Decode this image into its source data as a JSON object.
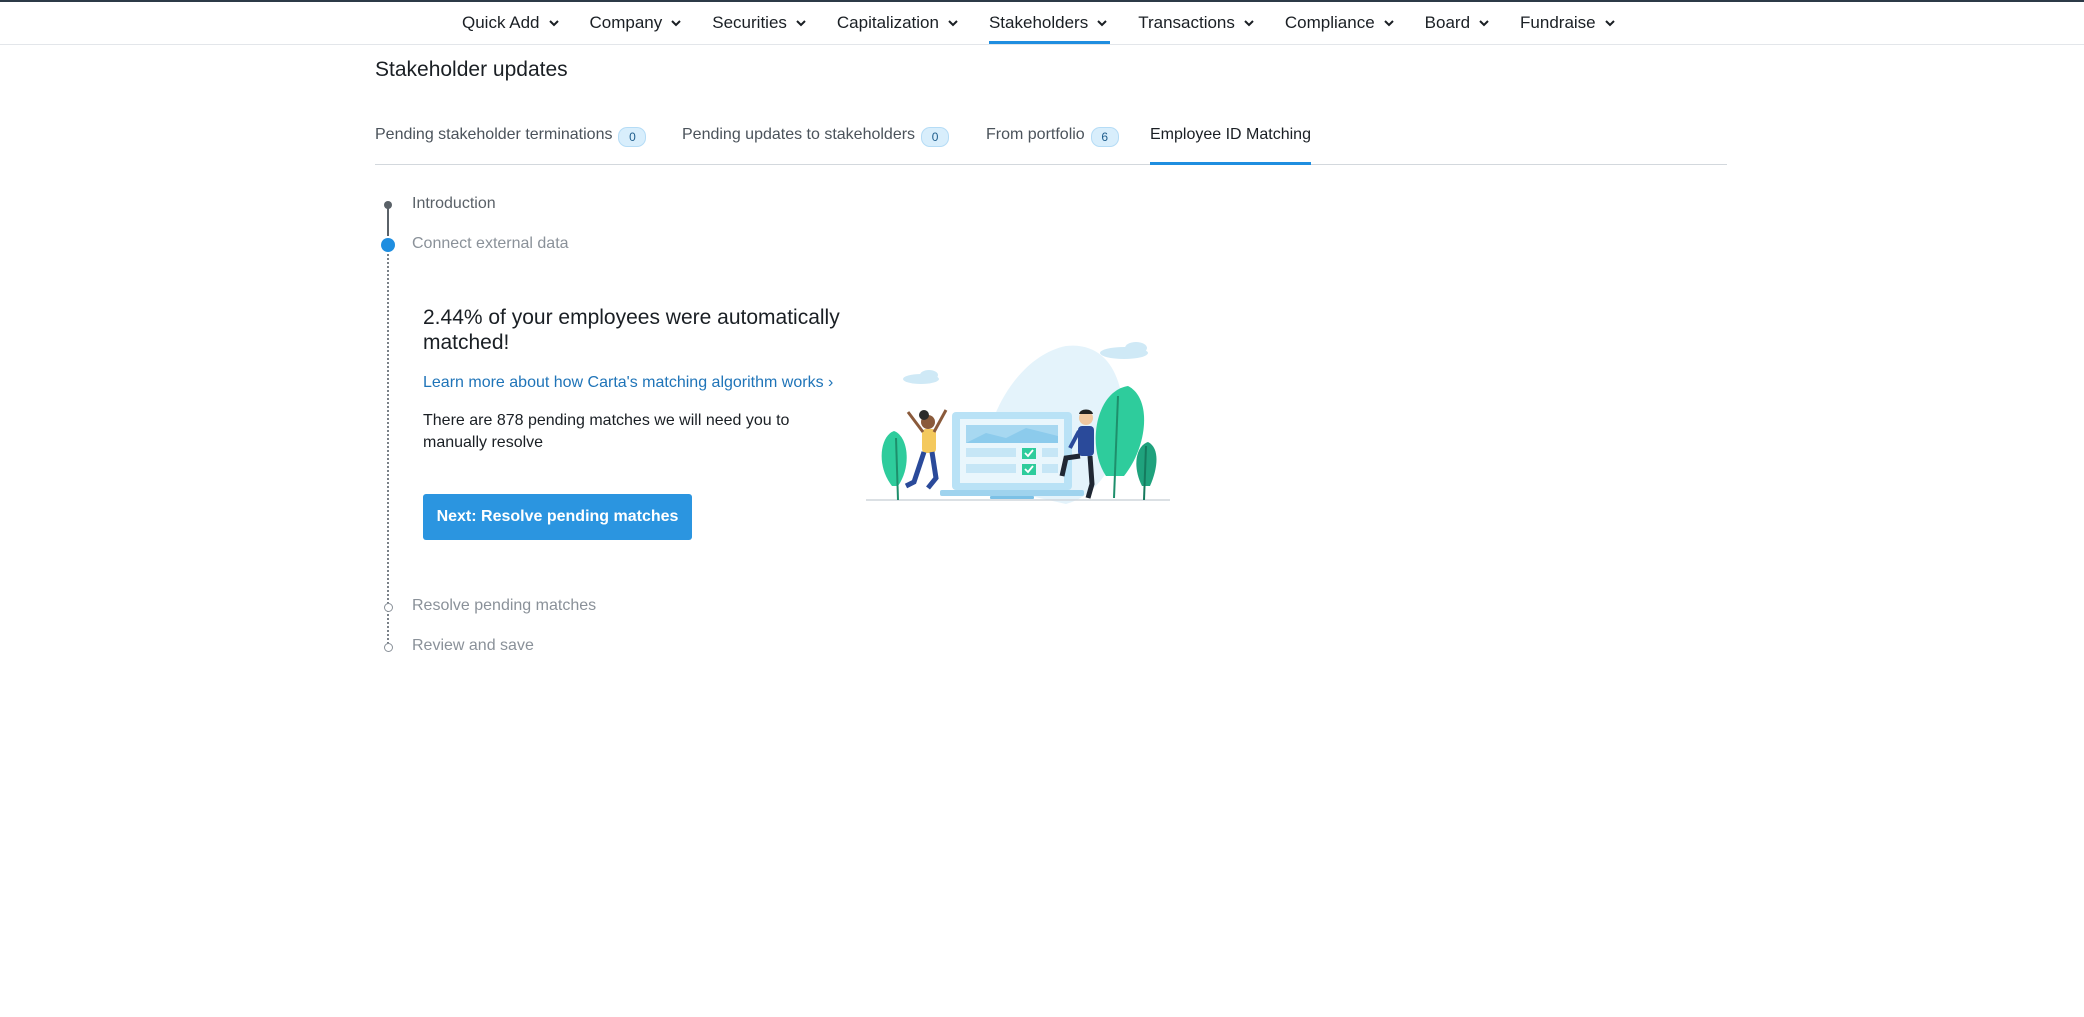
{
  "nav": {
    "items": [
      {
        "label": "Quick Add",
        "active": false
      },
      {
        "label": "Company",
        "active": false
      },
      {
        "label": "Securities",
        "active": false
      },
      {
        "label": "Capitalization",
        "active": false
      },
      {
        "label": "Stakeholders",
        "active": true
      },
      {
        "label": "Transactions",
        "active": false
      },
      {
        "label": "Compliance",
        "active": false
      },
      {
        "label": "Board",
        "active": false
      },
      {
        "label": "Fundraise",
        "active": false
      }
    ]
  },
  "page": {
    "title": "Stakeholder updates"
  },
  "tabs": [
    {
      "label": "Pending stakeholder terminations",
      "count": "0"
    },
    {
      "label": "Pending updates to stakeholders",
      "count": "0"
    },
    {
      "label": "From portfolio",
      "count": "6"
    },
    {
      "label": "Employee ID Matching",
      "active": true
    }
  ],
  "steps": [
    {
      "label": "Introduction",
      "state": "done"
    },
    {
      "label": "Connect external data",
      "state": "current"
    },
    {
      "label": "Resolve pending matches",
      "state": "pending"
    },
    {
      "label": "Review and save",
      "state": "pending"
    }
  ],
  "content": {
    "heading": "2.44% of your employees were automatically matched!",
    "learn_link": "Learn more about how Carta's matching algorithm works ›",
    "pending_text": "There are 878 pending matches we will need you to manually resolve",
    "next_button": "Next: Resolve pending matches"
  },
  "colors": {
    "accent": "#1f8ee0",
    "button": "#2b95e0",
    "link": "#1f74b8",
    "badge_bg": "#d8eefc"
  }
}
